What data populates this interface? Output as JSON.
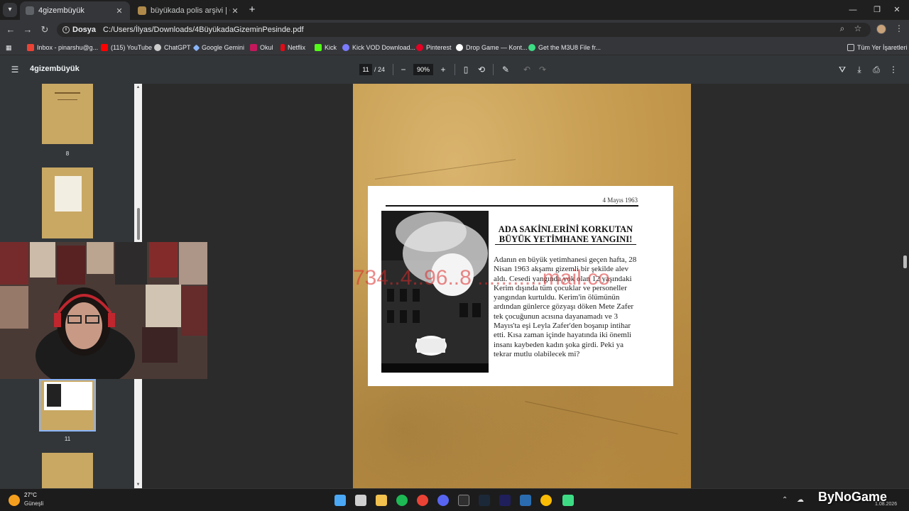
{
  "browser": {
    "tabs": [
      {
        "title": "4gizembüyük",
        "active": true
      },
      {
        "title": "büyükada polis arşivi | Gizemin",
        "active": false
      }
    ],
    "new_tab": "+",
    "site_chip": "Dosya",
    "url": "C:/Users/İlyas/Downloads/4BüyükadaGizeminPesinde.pdf"
  },
  "bookmarks": {
    "items": [
      {
        "label": "Inbox - pinarshu@g...",
        "color": "#ea4335"
      },
      {
        "label": "(115) YouTube",
        "color": "#ff0000"
      },
      {
        "label": "ChatGPT",
        "color": "#cccccc"
      },
      {
        "label": "Google Gemini",
        "color": "#8ab4f8"
      },
      {
        "label": "Okul",
        "color": "#c2185b"
      },
      {
        "label": "Netflix",
        "color": "#e50914"
      },
      {
        "label": "Kick",
        "color": "#53fc18"
      },
      {
        "label": "Kick VOD Download...",
        "color": "#7b7bff"
      },
      {
        "label": "Pinterest",
        "color": "#e60023"
      },
      {
        "label": "Drop Game — Kont...",
        "color": "#ffffff"
      },
      {
        "label": "Get the M3U8 File fr...",
        "color": "#3ddc84"
      }
    ],
    "all_bookmarks": "Tüm Yer İşaretleri"
  },
  "pdf_toolbar": {
    "title": "4gizembüyük",
    "page_current": "11",
    "page_total": "/ 24",
    "zoom": "90%"
  },
  "sidebar": {
    "thumb_labels": [
      "8",
      "11"
    ]
  },
  "document": {
    "date": "4 Mayıs 1963",
    "headline": "ADA SAKİNLERİNİ KORKUTAN BÜYÜK YETİMHANE YANGINI!",
    "body": "Adanın en büyük yetimhanesi geçen hafta, 28 Nisan 1963 akşamı gizemli bir şekilde alev aldı. Cesedi yangında yok olan 12 yaşındaki Kerim dışında tüm çocuklar ve personeller yangından kurtuldu. Kerim'in ölümünün ardından günlerce gözyaşı döken Mete Zafer tek çocuğunun acısına dayanamadı ve 3 Mayıs'ta  eşi Leyla Zafer'den boşanıp intihar etti. Kısa zaman içinde hayatında iki önemli insanı kaybeden kadın şoka girdi. Peki ya tekrar mutlu olabilecek mi?",
    "watermark": "734..4..96..8 ...........mail.co"
  },
  "taskbar": {
    "weather_temp": "27°C",
    "weather_desc": "Güneşli",
    "logo_text": "ByNoGame",
    "date_fragment": "1.08.2026"
  }
}
